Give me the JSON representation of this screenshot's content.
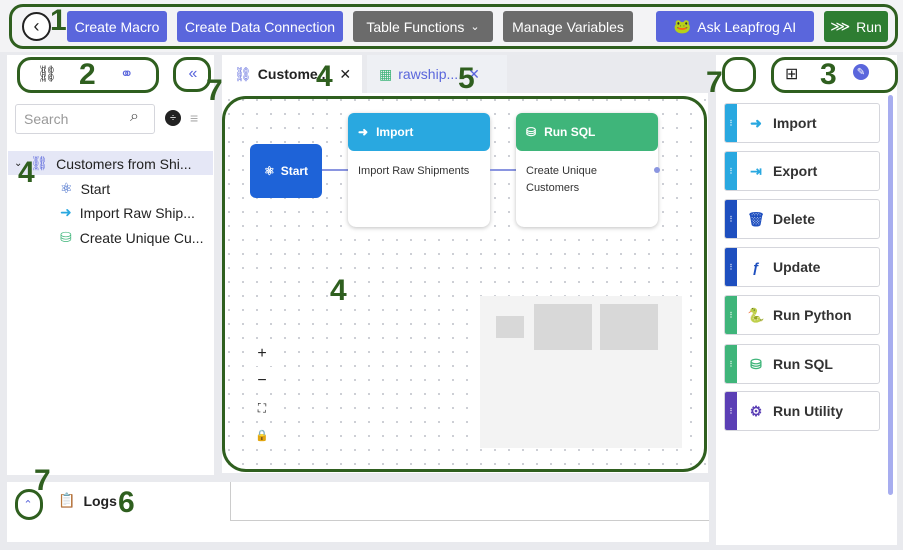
{
  "toolbar": {
    "back_label": "‹",
    "create_macro": "Create Macro",
    "create_data_connection": "Create Data Connection",
    "table_functions": "Table Functions",
    "manage_variables": "Manage Variables",
    "ask_ai": "Ask Leapfrog AI",
    "run": "Run"
  },
  "left_panel": {
    "search_placeholder": "Search",
    "tree": {
      "root": "Customers from Shi...",
      "children": [
        "Start",
        "Import Raw Ship...",
        "Create Unique Cu..."
      ]
    }
  },
  "tabs": [
    {
      "label": "Custome..."
    },
    {
      "label": "rawship..."
    }
  ],
  "canvas": {
    "start_label": "Start",
    "nodes": [
      {
        "header": "Import",
        "body": "Import Raw Shipments"
      },
      {
        "header": "Run SQL",
        "body": "Create Unique Customers"
      }
    ]
  },
  "zoom": {
    "in": "+",
    "out": "−",
    "fit": "⛶",
    "lock": "🔒"
  },
  "right_panel": {
    "items": [
      {
        "label": "Import",
        "color": "#29a8e0"
      },
      {
        "label": "Export",
        "color": "#29a8e0"
      },
      {
        "label": "Delete",
        "color": "#1e4fbf"
      },
      {
        "label": "Update",
        "color": "#1e4fbf"
      },
      {
        "label": "Run Python",
        "color": "#3fb57a"
      },
      {
        "label": "Run SQL",
        "color": "#3fb57a"
      },
      {
        "label": "Run Utility",
        "color": "#5b3fb5"
      }
    ]
  },
  "logs": {
    "label": "Logs"
  },
  "annotations": {
    "n1": "1",
    "n2": "2",
    "n3": "3",
    "n4a": "4",
    "n4b": "4",
    "n4c": "4",
    "n5": "5",
    "n6": "6",
    "n7a": "7",
    "n7b": "7",
    "n7c": "7"
  }
}
